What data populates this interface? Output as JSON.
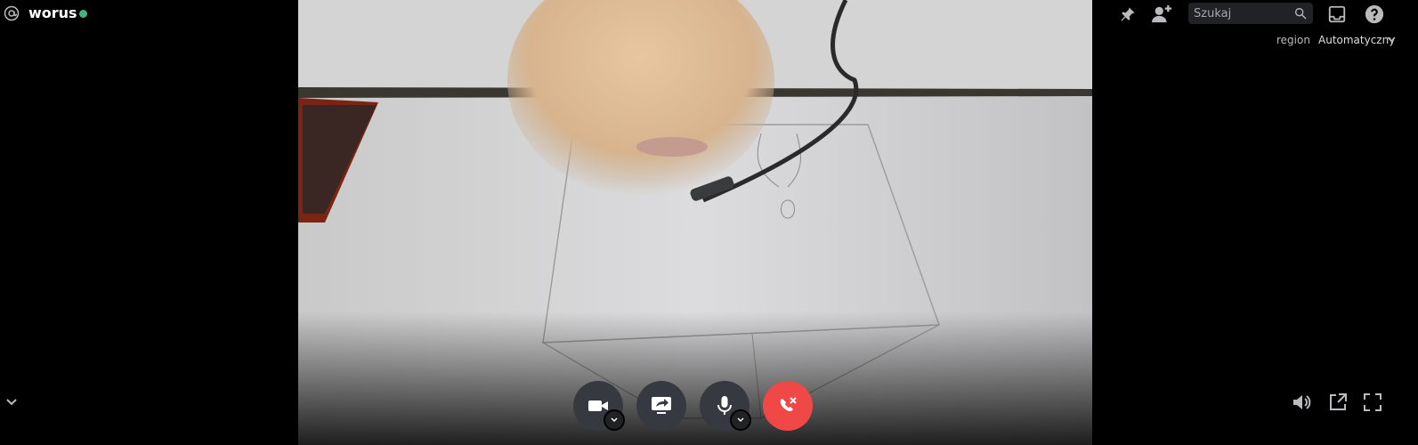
{
  "header": {
    "username": "worus",
    "status_color": "#43b581",
    "icons": [
      "at-icon",
      "pin-icon",
      "add-member-icon",
      "search-icon",
      "inbox-icon",
      "help-icon"
    ]
  },
  "search": {
    "placeholder": "Szukaj"
  },
  "region": {
    "label": "region",
    "value": "Automatyczny"
  },
  "controls": {
    "icons": [
      "camera-icon",
      "screen-share-icon",
      "microphone-icon",
      "disconnect-icon"
    ],
    "accent_red": "#f04747"
  },
  "bottom_right": {
    "icons": [
      "volume-icon",
      "popout-icon",
      "fullscreen-icon"
    ]
  }
}
